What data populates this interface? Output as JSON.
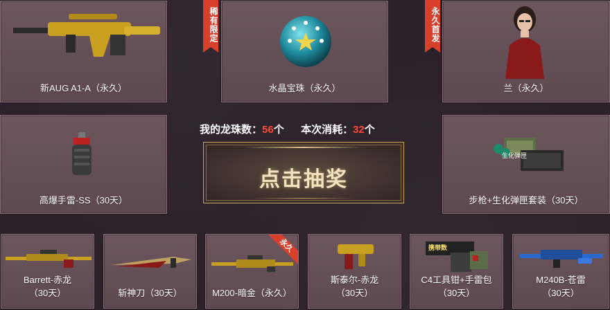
{
  "prizes_top": [
    {
      "name": "新AUG A1-A（永久）",
      "badge": ""
    },
    {
      "name": "水晶宝珠（永久）",
      "badge": "稀有限定"
    },
    {
      "name": "兰（永久）",
      "badge": "永久首发"
    }
  ],
  "prizes_mid": [
    {
      "name": "高爆手雷-SS（30天）"
    },
    {
      "name": "步枪+生化弹匣套装（30天）",
      "art_caption": "生化弹匣"
    }
  ],
  "prizes_bottom": [
    {
      "line1": "Barrett-赤龙",
      "line2": "（30天）",
      "badge": ""
    },
    {
      "line1": "斩神刀（30天）",
      "line2": "",
      "badge": ""
    },
    {
      "line1": "M200-暗金（永久）",
      "line2": "",
      "badge": "永久"
    },
    {
      "line1": "斯泰尔-赤龙",
      "line2": "（30天）",
      "badge": ""
    },
    {
      "line1": "C4工具钳+手雷包",
      "line2": "（30天）",
      "badge": "",
      "art_caption": "携带数"
    },
    {
      "line1": "M240B-苍雷",
      "line2": "（30天）",
      "badge": ""
    }
  ],
  "stats": {
    "owned_label": "我的龙珠数：",
    "owned_value": "56",
    "owned_unit": "个",
    "cost_label": "本次消耗：",
    "cost_value": "32",
    "cost_unit": "个"
  },
  "draw_button": {
    "label": "点击抽奖"
  },
  "colors": {
    "accent_red": "#ff4a3a",
    "ribbon": "#d9402b",
    "gold": "#c9a45c"
  }
}
